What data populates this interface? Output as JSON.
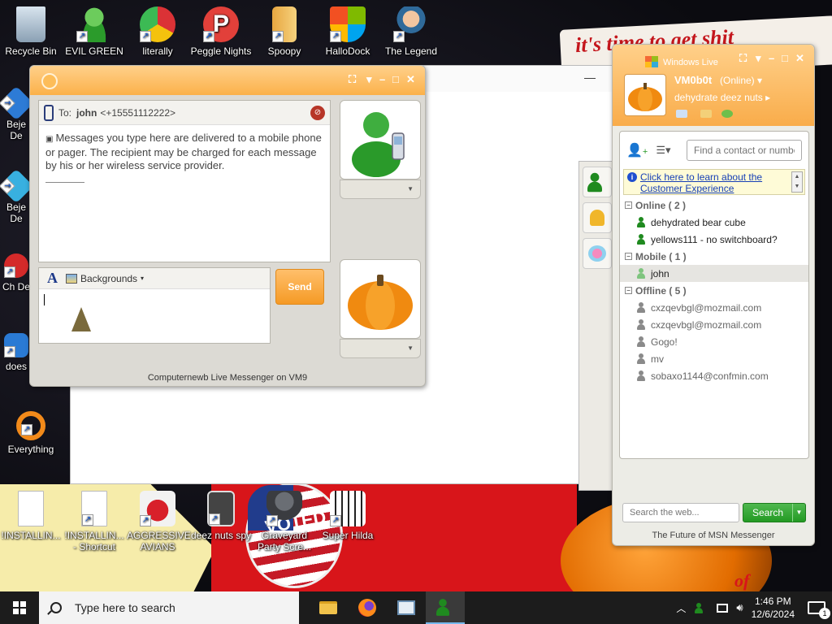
{
  "desktop": {
    "icons": [
      {
        "label": "Recycle Bin"
      },
      {
        "label": "EVIL GREEN"
      },
      {
        "label": "literally"
      },
      {
        "label": "Peggle Nights"
      },
      {
        "label": "Spoopy"
      },
      {
        "label": "HalloDock"
      },
      {
        "label": "The Legend"
      },
      {
        "label": "Beje De"
      },
      {
        "label": "Beje De"
      },
      {
        "label": "Ch De"
      },
      {
        "label": "does"
      },
      {
        "label": "Everything"
      },
      {
        "label": "!INSTALLIN..."
      },
      {
        "label": "!INSTALLIN... - Shortcut"
      },
      {
        "label": "AGGRESSIVE AVIANS"
      },
      {
        "label": "deez nuts spy"
      },
      {
        "label": "Graveyard Party Scre..."
      },
      {
        "label": "Super Hilda"
      }
    ],
    "wallpaper_text": "it's time to get shit",
    "wallpaper_sticker": "VOTED",
    "wallpaper_corner_text": "of"
  },
  "chat_window": {
    "to_label": "To:",
    "contact_name": "john",
    "contact_number": "<+15551112222>",
    "notice": "Messages you type here are delivered to a mobile phone or pager. The recipient may be charged for each message by his or her wireless service provider.",
    "font_icon": "A",
    "backgrounds_label": "Backgrounds",
    "send_label": "Send",
    "status_text": "Computernewb Live Messenger on VM9"
  },
  "contacts_window": {
    "brand": "Windows Live",
    "user_name": "VM0b0t",
    "user_status": "(Online)",
    "personal_message": "dehydrate deez nuts",
    "search_placeholder": "Find a contact or numbe",
    "info_link": "Click here to learn about the Customer Experience",
    "groups": [
      {
        "name": "Online ( 2 )",
        "contacts": [
          {
            "name": "dehydrated bear cube",
            "status": "online"
          },
          {
            "name": "yellows111 - no switchboard?",
            "status": "online"
          }
        ]
      },
      {
        "name": "Mobile ( 1 )",
        "contacts": [
          {
            "name": "john",
            "status": "mobile"
          }
        ]
      },
      {
        "name": "Offline ( 5 )",
        "contacts": [
          {
            "name": "cxzqevbgl@mozmail.com",
            "status": "offline"
          },
          {
            "name": "cxzqevbgl@mozmail.com",
            "status": "offline"
          },
          {
            "name": "Gogo!",
            "status": "offline"
          },
          {
            "name": "mv",
            "status": "offline"
          },
          {
            "name": "sobaxo1144@confmin.com",
            "status": "offline"
          }
        ]
      }
    ],
    "web_search_placeholder": "Search the web...",
    "search_button": "Search",
    "footer": "The Future of MSN Messenger"
  },
  "taskbar": {
    "search_placeholder": "Type here to search",
    "time": "1:46 PM",
    "date": "12/6/2024",
    "notification_count": "1"
  },
  "colors": {
    "accent_orange": "#f9ac4a",
    "online_green": "#1f8a1f",
    "link_blue": "#1740b6"
  }
}
